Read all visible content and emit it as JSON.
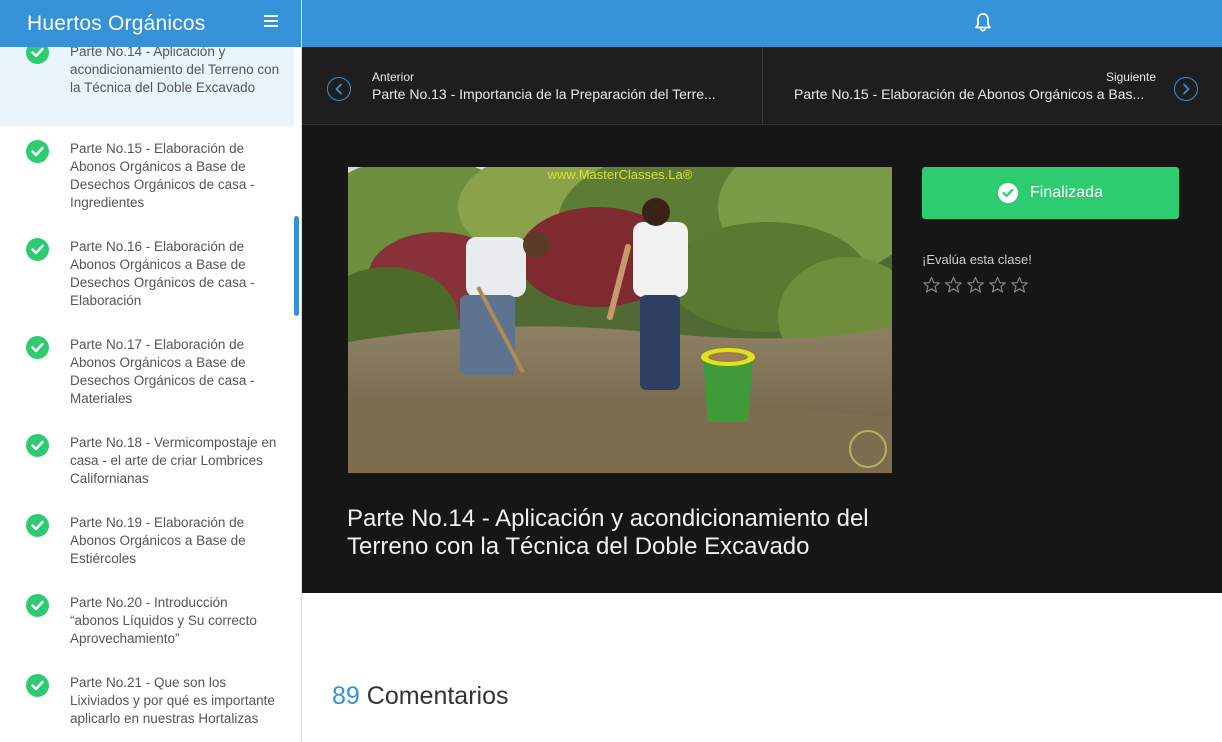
{
  "app": {
    "title": "Huertos Orgánicos"
  },
  "sidebar": {
    "lessons": [
      {
        "label": "Parte No.14 - Aplicación y acondicionamiento del Terreno con la Técnica del Doble Excavado",
        "completed": true,
        "active": true
      },
      {
        "label": "Parte No.15 - Elaboración de Abonos Orgánicos a Base de Desechos Orgánicos de casa - Ingredientes",
        "completed": true
      },
      {
        "label": "Parte No.16 - Elaboración de Abonos Orgánicos a Base de Desechos Orgánicos de casa - Elaboración",
        "completed": true
      },
      {
        "label": "Parte No.17 - Elaboración de Abonos Orgánicos a Base de Desechos Orgánicos de casa - Materiales",
        "completed": true
      },
      {
        "label": "Parte No.18 - Vermicompostaje en casa - el arte de criar Lombrices Californianas",
        "completed": true
      },
      {
        "label": "Parte No.19 - Elaboración de Abonos Orgánicos a Base de Estiércoles",
        "completed": true
      },
      {
        "label": "Parte No.20 - Introducción “abonos Líquidos y Su correcto Aprovechamiento”",
        "completed": true
      },
      {
        "label": "Parte No.21 - Que son los Lixiviados y por qué es importante aplicarlo en nuestras Hortalizas",
        "completed": true
      }
    ]
  },
  "nav": {
    "prev_label": "Anterior",
    "prev_title": "Parte No.13 - Importancia de la Preparación del Terre...",
    "next_label": "Siguiente",
    "next_title": "Parte No.15 - Elaboración de Abonos Orgánicos a Bas..."
  },
  "video": {
    "watermark": "www.MasterClasses.La®"
  },
  "lesson": {
    "title": "Parte No.14 - Aplicación y acondicionamiento del Terreno con la Técnica del Doble Excavado",
    "finish_label": "Finalizada",
    "rate_label": "¡Evalúa esta clase!",
    "rating": 0,
    "rating_max": 5
  },
  "comments": {
    "count": "89",
    "label": "Comentarios"
  },
  "colors": {
    "primary": "#3591d8",
    "success": "#2ecc71",
    "dark": "#161616"
  }
}
